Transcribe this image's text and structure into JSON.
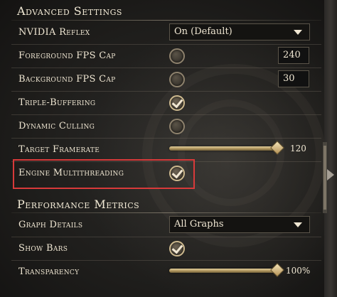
{
  "sections": {
    "advanced": "Advanced Settings",
    "performance": "Performance Metrics"
  },
  "rows": {
    "nvidia_reflex": {
      "label": "NVIDIA Reflex",
      "value": "On (Default)"
    },
    "foreground_fps_cap": {
      "label": "Foreground FPS Cap",
      "checked": false,
      "value": "240"
    },
    "background_fps_cap": {
      "label": "Background FPS Cap",
      "checked": false,
      "value": "30"
    },
    "triple_buffering": {
      "label": "Triple-Buffering",
      "checked": true
    },
    "dynamic_culling": {
      "label": "Dynamic Culling",
      "checked": false
    },
    "target_framerate": {
      "label": "Target Framerate",
      "value": "120",
      "level": 1.0
    },
    "engine_multithreading": {
      "label": "Engine Multithreading",
      "checked": true
    },
    "graph_details": {
      "label": "Graph Details",
      "value": "All Graphs"
    },
    "show_bars": {
      "label": "Show Bars",
      "checked": true
    },
    "transparency": {
      "label": "Transparency",
      "value": "100%",
      "level": 1.0
    }
  },
  "colors": {
    "highlight": "#d83a3a",
    "accent_gold": "#c7ab6a"
  },
  "icons": {
    "dropdown": "chevron-down-icon",
    "checkbox_checked": "checkmark-icon",
    "scroll": "scroll-right-arrow-icon"
  }
}
